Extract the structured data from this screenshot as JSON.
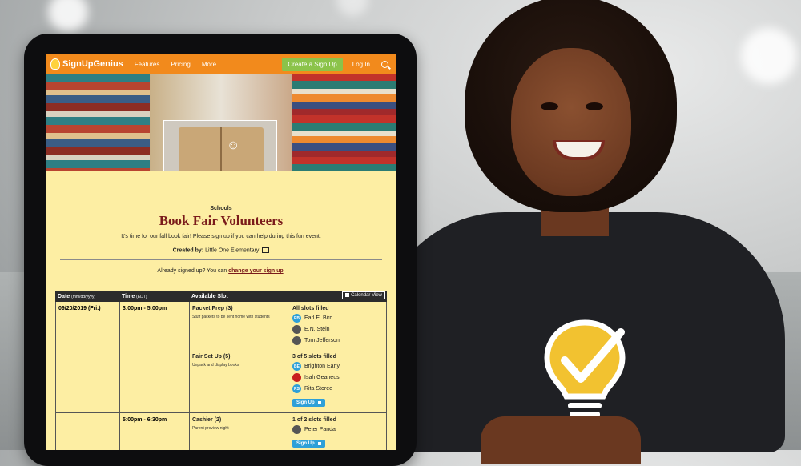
{
  "nav": {
    "logo": "SignUpGenius",
    "links": [
      "Features",
      "Pricing",
      "More"
    ],
    "create_button": "Create a Sign Up",
    "login": "Log In"
  },
  "event": {
    "category": "Schools",
    "title": "Book Fair Volunteers",
    "description": "It's time for our fall book fair!  Please sign up if you can help during this fun event.",
    "created_by_label": "Created by:",
    "created_by": "Little One Elementary",
    "already_text": "Already signed up? You can",
    "already_link": "change your sign up",
    "already_end": "."
  },
  "table": {
    "headers": {
      "date": "Date",
      "date_fmt": "(mm/dd/yyyy)",
      "time": "Time",
      "time_zone": "(EDT)",
      "slot": "Available Slot",
      "calendar_button": "Calendar View"
    },
    "date": "09/20/2019 (Fri.)",
    "rows": [
      {
        "time": "3:00pm - 5:00pm",
        "slots": [
          {
            "title": "Packet Prep (3)",
            "sub": "Stuff packets to be sent home with students",
            "status": "All slots filled",
            "volunteers": [
              {
                "initials": "EB",
                "name": "Earl E. Bird"
              },
              {
                "initials": "",
                "name": "E.N. Stein"
              },
              {
                "initials": "",
                "name": "Tom Jefferson"
              }
            ]
          },
          {
            "title": "Fair Set Up (5)",
            "sub": "Unpack and display books",
            "status": "3 of 5 slots filled",
            "volunteers": [
              {
                "initials": "BE",
                "name": "Brighton Early"
              },
              {
                "initials": "",
                "name": "Isah Geaneus"
              },
              {
                "initials": "RS",
                "name": "Rita Storee"
              }
            ],
            "button": "Sign Up"
          }
        ]
      },
      {
        "time": "5:00pm - 6:30pm",
        "slots": [
          {
            "title": "Cashier (2)",
            "sub": "Parent preview night",
            "status": "1 of 2 slots filled",
            "volunteers": [
              {
                "initials": "",
                "name": "Peter Panda"
              }
            ],
            "button": "Sign Up"
          }
        ]
      }
    ]
  }
}
